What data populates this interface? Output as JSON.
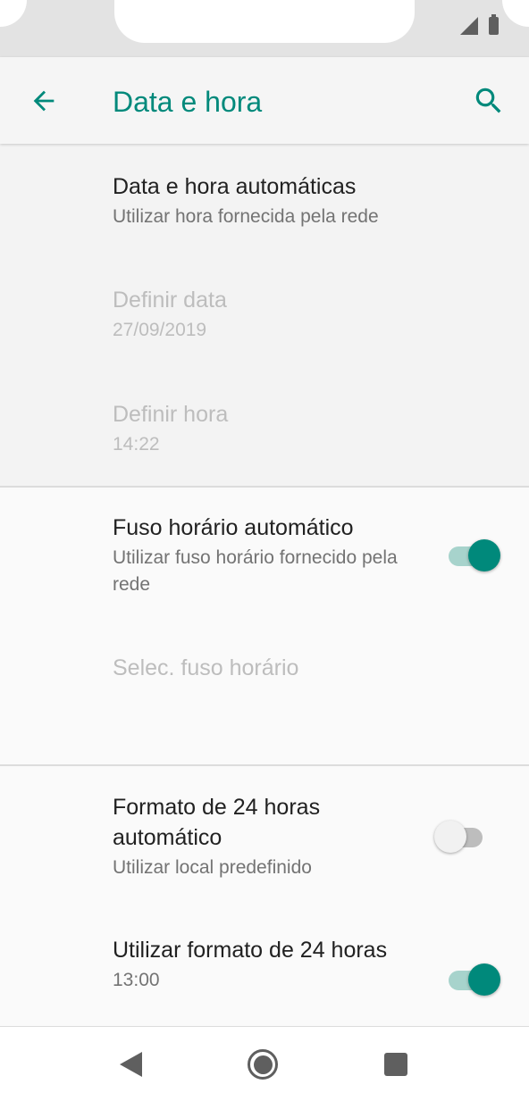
{
  "app_bar": {
    "title": "Data e hora",
    "back_icon": "arrow-back-icon",
    "search_icon": "search-icon",
    "accent_color": "#00897b"
  },
  "status_bar": {
    "icons": [
      "signal-icon",
      "battery-icon"
    ]
  },
  "preferences": [
    {
      "title": "Data e hora automáticas",
      "summary": "Utilizar hora fornecida pela rede",
      "enabled": true
    },
    {
      "title": "Definir data",
      "summary": "27/09/2019",
      "enabled": false
    },
    {
      "title": "Definir hora",
      "summary": "14:22",
      "enabled": false
    },
    {
      "title": "Fuso horário automático",
      "summary": "Utilizar fuso horário fornecido pela rede",
      "enabled": true,
      "switch": "on"
    },
    {
      "title": "Selec. fuso horário",
      "enabled": false
    },
    {
      "title": "Formato de 24 horas automático",
      "summary": "Utilizar local predefinido",
      "enabled": true,
      "switch": "off"
    },
    {
      "title": "Utilizar formato de 24 horas",
      "summary": "13:00",
      "enabled": true,
      "switch": "on"
    }
  ],
  "nav_bar": {
    "icons": [
      "nav-back-icon",
      "nav-home-icon",
      "nav-recents-icon"
    ]
  }
}
